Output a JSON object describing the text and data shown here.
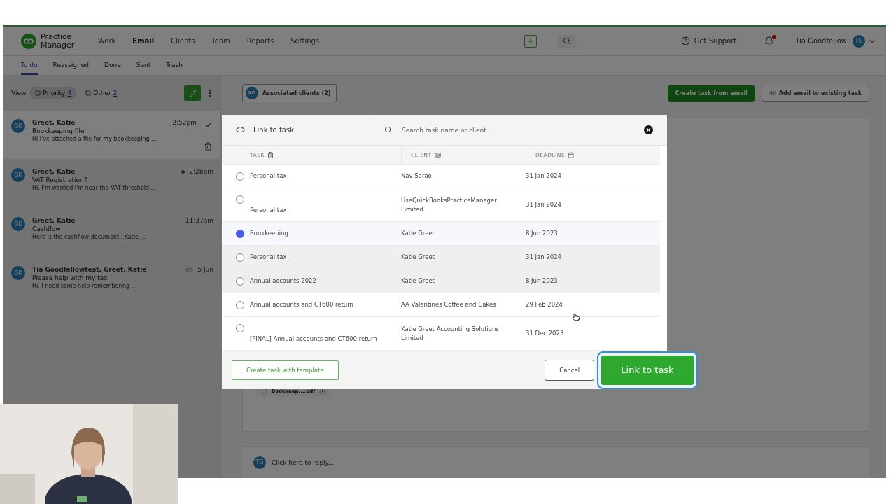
{
  "app": {
    "product": "Practice Manager",
    "nav": [
      {
        "label": "Work",
        "selected": false
      },
      {
        "label": "Email",
        "selected": true
      },
      {
        "label": "Clients",
        "selected": false
      },
      {
        "label": "Team",
        "selected": false
      },
      {
        "label": "Reports",
        "selected": false
      },
      {
        "label": "Settings",
        "selected": false
      }
    ],
    "header": {
      "support": "Get Support",
      "notification": true,
      "user": "Tia Goodfellow",
      "user_initials": "TG"
    },
    "subtabs": [
      {
        "label": "To do",
        "selected": true
      },
      {
        "label": "Reassigned",
        "selected": false
      },
      {
        "label": "Done",
        "selected": false
      },
      {
        "label": "Sent",
        "selected": false
      },
      {
        "label": "Trash",
        "selected": false
      }
    ],
    "view": {
      "label": "View",
      "filters": [
        {
          "label": "Priority",
          "count": "4",
          "selected": true
        },
        {
          "label": "Other",
          "count": "2",
          "selected": false
        }
      ]
    },
    "emails": [
      {
        "initials": "GK",
        "sender": "Greet, Katie",
        "subject": "Bookkeeping file",
        "preview": "Hi I've attached a file for my bookkeeping ...",
        "time": "2:52pm",
        "selected": true,
        "unread": false,
        "linked": false
      },
      {
        "initials": "GK",
        "sender": "Greet, Katie",
        "subject": "VAT Registration?",
        "preview": "Hi, I'm worried I'm near the VAT threshold ...",
        "time": "2:28pm",
        "selected": false,
        "unread": true,
        "linked": false
      },
      {
        "initials": "GK",
        "sender": "Greet, Katie",
        "subject": "Cashflow",
        "preview": "Here is the cashflow document . Katie ...",
        "time": "11:37am",
        "selected": false,
        "unread": false,
        "linked": false
      },
      {
        "initials": "GK",
        "sender": "Tia Goodfellowtest, Greet, Katie",
        "subject": "Please help with my tax",
        "preview": "Hi,   I need some help remembering ...",
        "time": "5 Jun",
        "selected": false,
        "unread": false,
        "linked": true
      }
    ],
    "detail": {
      "associated": "Associated clients (2)",
      "associated_initials": "XO",
      "create_button": "Create task from email",
      "add_button": "Add email to existing task",
      "attachment": "Bookkeep....pdf",
      "reply": {
        "initials": "TG",
        "placeholder": "Click here to reply..."
      }
    }
  },
  "modal": {
    "title": "Link to task",
    "search": {
      "placeholder": "Search task name or client..."
    },
    "columns": [
      "TASK",
      "CLIENT",
      "DEADLINE"
    ],
    "rows": [
      {
        "task": "Personal tax",
        "client": "Nav Sarao",
        "deadline": "31 Jan 2024",
        "selected": false,
        "shaded": false
      },
      {
        "task": "Personal tax",
        "client": "UseQuickBooksPracticeManager Limited",
        "deadline": "31 Jan 2024",
        "selected": false,
        "shaded": false
      },
      {
        "task": "Bookkeeping",
        "client": "Katie Greet",
        "deadline": "8 Jun 2023",
        "selected": true,
        "shaded": false
      },
      {
        "task": "Personal tax",
        "client": "Katie Greet",
        "deadline": "31 Jan 2024",
        "selected": false,
        "shaded": true
      },
      {
        "task": "Annual accounts 2022",
        "client": "Katie Greet",
        "deadline": "8 Jun 2023",
        "selected": false,
        "shaded": true
      },
      {
        "task": "Annual accounts and CT600 return",
        "client": "AA Valentines Coffee and Cakes",
        "deadline": "29 Feb 2024",
        "selected": false,
        "shaded": false
      },
      {
        "task": "[FINAL] Annual accounts and CT600 return",
        "client": "Katie Greet Accounting Solutions Limited",
        "deadline": "31 Dec 2023",
        "selected": false,
        "shaded": false
      }
    ],
    "template_button": "Create task with template",
    "cancel_button": "Cancel",
    "link_button": {
      "label": "Link to task",
      "focused": true
    }
  }
}
